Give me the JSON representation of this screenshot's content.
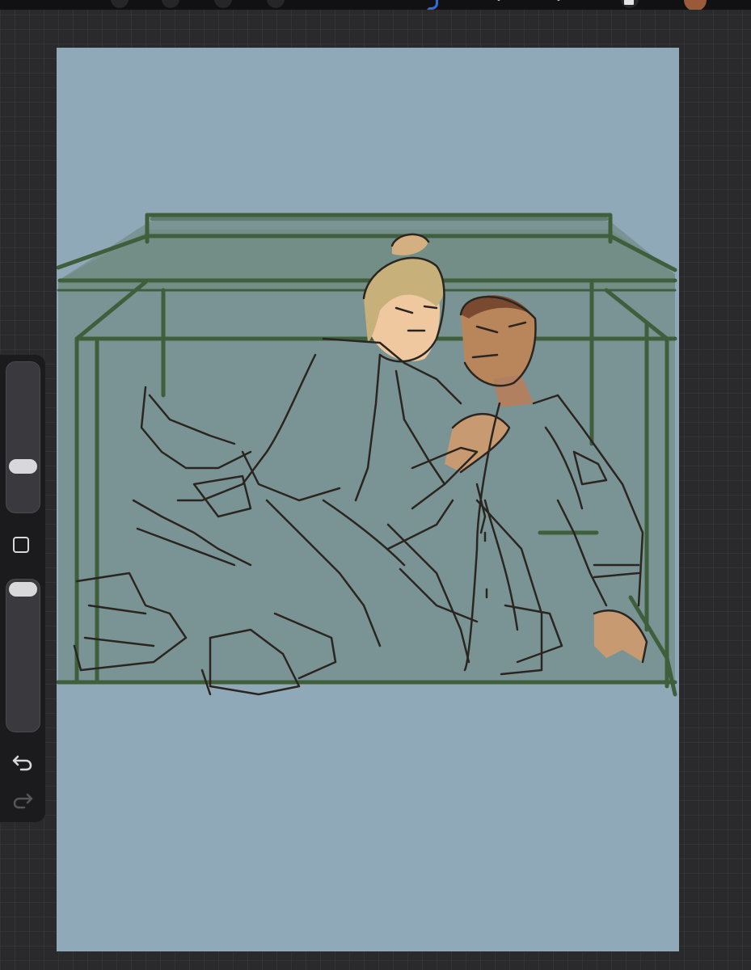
{
  "app": {
    "toolbar": {
      "left_icons": [
        "gallery-icon",
        "adjustments-icon",
        "selection-icon",
        "transform-icon"
      ],
      "right_icons": [
        "brush-icon",
        "smudge-icon",
        "eraser-icon",
        "layers-icon",
        "color-icon"
      ],
      "accent_color": "#2f6dde",
      "current_color": "#9a5a3a"
    },
    "sidebar": {
      "brush_size_slider": {
        "level": 0.72
      },
      "opacity_slider": {
        "level": 0.0
      },
      "modify_button_icon": "square-icon",
      "undo_icon": "undo-arrow-icon",
      "redo_icon": "redo-arrow-icon"
    },
    "canvas": {
      "background_color": "#90a9b8",
      "sketch_line_color": "#2b2520",
      "structure_color": "#3f5f3c",
      "skin_tone_left": "#f0c8a0",
      "skin_tone_right": "#b8865a",
      "hair_left": "#c8b07a",
      "hair_right": "#7a4a30"
    }
  }
}
